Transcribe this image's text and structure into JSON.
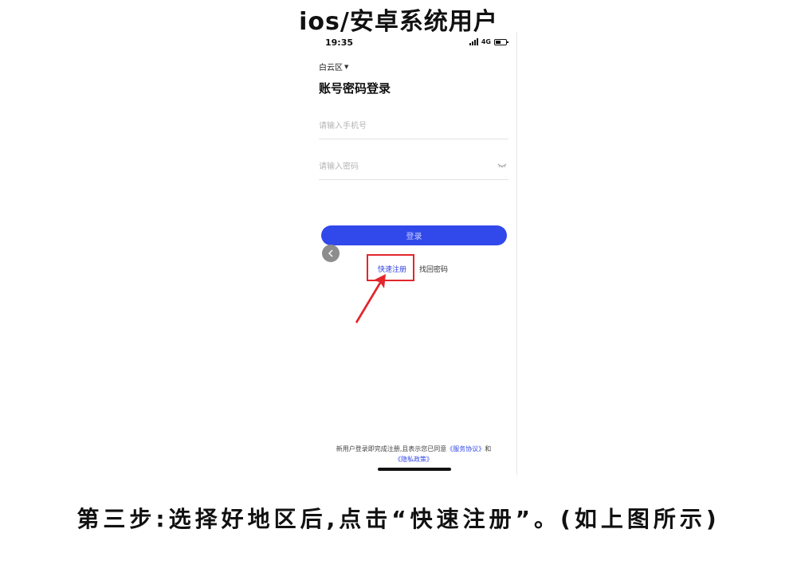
{
  "header": {
    "title": "ios/安卓系统用户"
  },
  "status_bar": {
    "time": "19:35",
    "network": "4G"
  },
  "login": {
    "region": "白云区",
    "title": "账号密码登录",
    "phone_placeholder": "请输入手机号",
    "password_placeholder": "请输入密码",
    "login_button": "登录",
    "quick_register": "快速注册",
    "find_password": "找回密码"
  },
  "agreement": {
    "prefix": "新用户登录即完成注册,且表示您已同意",
    "service_link": "《服务协议》",
    "conjunction": "和",
    "privacy_link": "《隐私政策》"
  },
  "caption": {
    "text": "第三步:选择好地区后,点击“快速注册”。(如上图所示)"
  },
  "colors": {
    "accent": "#3148ea",
    "annotation": "#e3262b"
  }
}
